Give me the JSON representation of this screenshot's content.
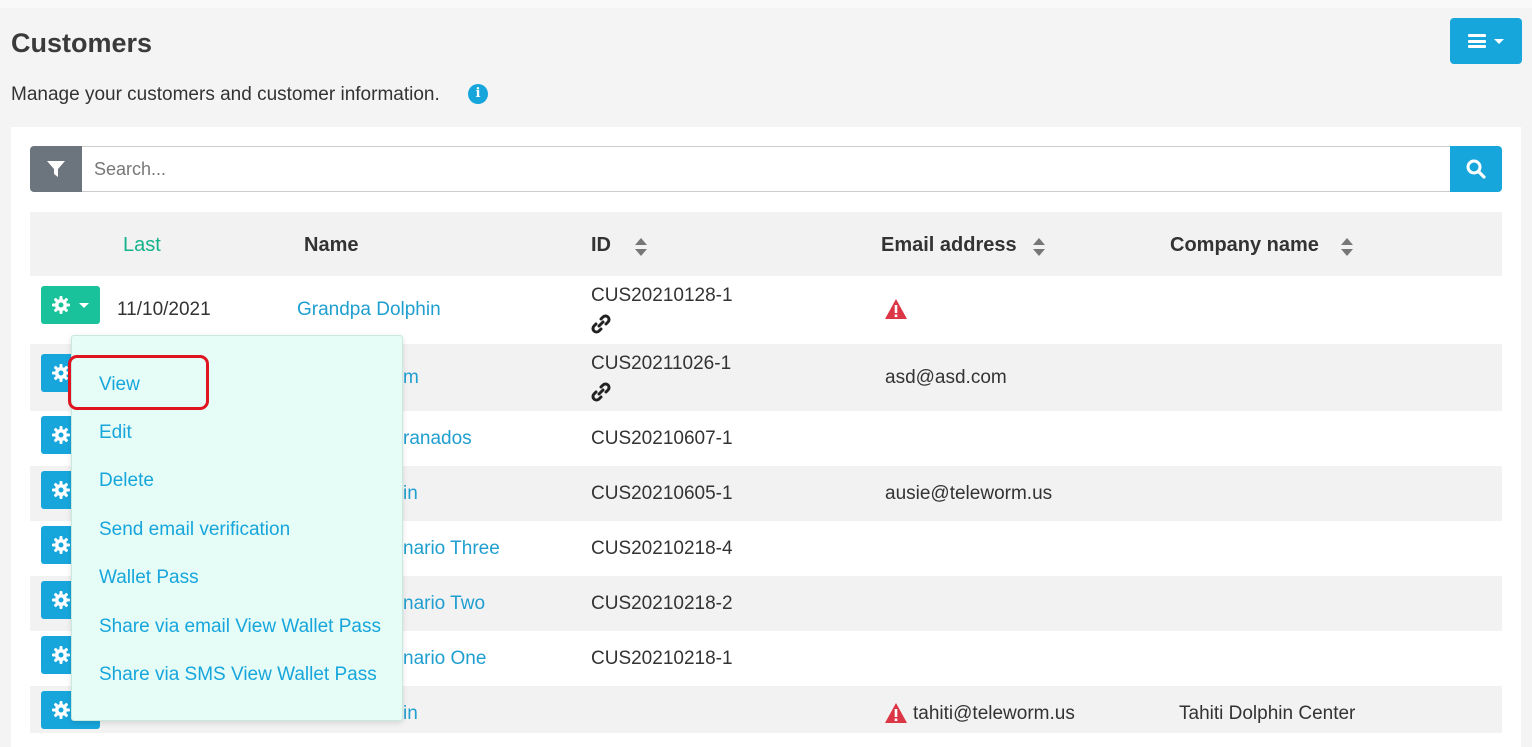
{
  "page": {
    "title": "Customers",
    "subtitle": "Manage your customers and customer information."
  },
  "search": {
    "placeholder": "Search..."
  },
  "table": {
    "columns": [
      "Last",
      "Name",
      "ID",
      "Email address",
      "Company name"
    ],
    "rows": [
      {
        "last": "11/10/2021",
        "name": "Grandpa Dolphin",
        "id": "CUS20210128-1",
        "email": "",
        "company": ""
      },
      {
        "last": "",
        "name": "m",
        "id": "CUS20211026-1",
        "email": "asd@asd.com",
        "company": ""
      },
      {
        "last": "",
        "name": "ranados",
        "id": "CUS20210607-1",
        "email": "",
        "company": ""
      },
      {
        "last": "",
        "name": "in",
        "id": "CUS20210605-1",
        "email": "ausie@teleworm.us",
        "company": ""
      },
      {
        "last": "",
        "name": "nario Three",
        "id": "CUS20210218-4",
        "email": "",
        "company": ""
      },
      {
        "last": "",
        "name": "nario Two",
        "id": "CUS20210218-2",
        "email": "",
        "company": ""
      },
      {
        "last": "",
        "name": "nario One",
        "id": "CUS20210218-1",
        "email": "",
        "company": ""
      },
      {
        "last": "",
        "name": "in",
        "id": "",
        "email": "tahiti@teleworm.us",
        "company": "Tahiti Dolphin Center"
      }
    ]
  },
  "dropdown": {
    "items": [
      "View",
      "Edit",
      "Delete",
      "Send email verification",
      "Wallet Pass",
      "Share via email View Wallet Pass",
      "Share via SMS View Wallet Pass"
    ]
  },
  "colors": {
    "primary": "#17a6dc",
    "success": "#19c29a",
    "sorted_header": "#16b28c",
    "danger": "#dc3545",
    "highlight": "#e0141e",
    "dropdown_bg": "#e6fcf7"
  },
  "icons": [
    "hamburger-icon",
    "info-icon",
    "filter-icon",
    "search-icon",
    "gear-icon",
    "caret-down-icon",
    "warning-icon",
    "link-icon",
    "sort-icon"
  ]
}
